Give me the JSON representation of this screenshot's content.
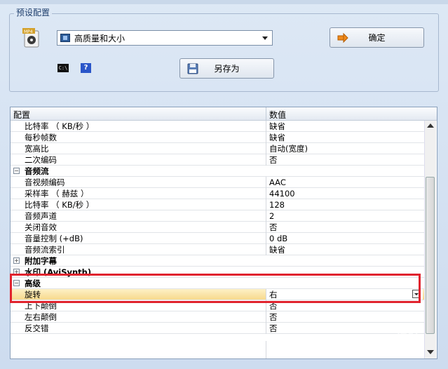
{
  "preset": {
    "group_title": "预设配置",
    "selected_preset": "高质量和大小",
    "ok_label": "确定",
    "save_as_label": "另存为",
    "cmd_icon_text": "C:\\",
    "help_icon_text": "?"
  },
  "grid": {
    "headers": {
      "config": "配置",
      "value": "数值"
    },
    "rows": [
      {
        "name": "比特率 （ KB/秒 ）",
        "value": "缺省"
      },
      {
        "name": "每秒帧数",
        "value": "缺省"
      },
      {
        "name": "宽高比",
        "value": "自动(宽度)"
      },
      {
        "name": "二次编码",
        "value": "否"
      },
      {
        "name": "音频流",
        "value": "",
        "category": true,
        "expanded": true
      },
      {
        "name": "音视频编码",
        "value": "AAC"
      },
      {
        "name": "采样率 （ 赫兹 ）",
        "value": "44100"
      },
      {
        "name": "比特率 （ KB/秒 ）",
        "value": "128"
      },
      {
        "name": "音频声道",
        "value": "2"
      },
      {
        "name": "关闭音效",
        "value": "否"
      },
      {
        "name": "音量控制 (+dB)",
        "value": "0 dB"
      },
      {
        "name": "音频流索引",
        "value": "缺省"
      },
      {
        "name": "附加字幕",
        "value": "",
        "category": true,
        "expanded": false
      },
      {
        "name": "水印 (AviSynth)",
        "value": "",
        "category": true,
        "expanded": false
      },
      {
        "name": "高级",
        "value": "",
        "category": true,
        "expanded": true
      },
      {
        "name": "旋转",
        "value": "右",
        "selected": true
      },
      {
        "name": "上下颠倒",
        "value": "否"
      },
      {
        "name": "左右颠倒",
        "value": "否"
      },
      {
        "name": "反交错",
        "value": "否"
      }
    ]
  },
  "colors": {
    "highlight": "#e0232e",
    "selection": "#f7d98c"
  },
  "watermark": "Baidu 经验"
}
